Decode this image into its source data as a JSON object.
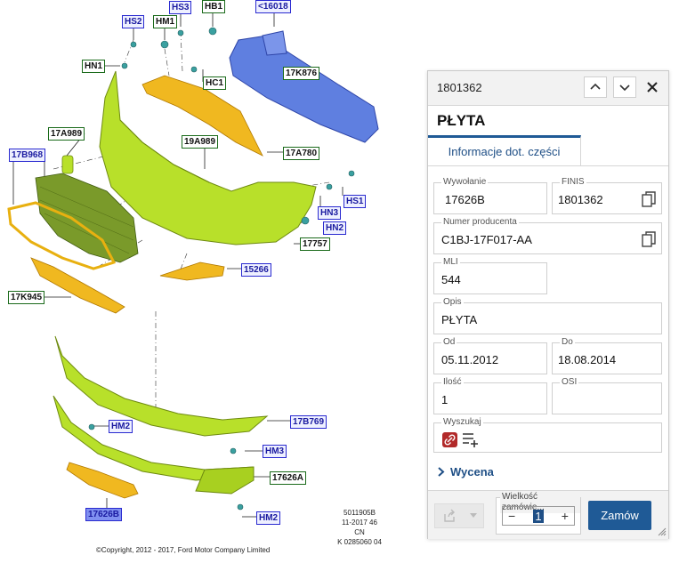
{
  "diagram": {
    "labels": [
      "HS2",
      "HM1",
      "HS3",
      "HB1",
      "<16018",
      "HN1",
      "HC1",
      "17K876",
      "17A989",
      "19A989",
      "17A780",
      "17B968",
      "HS1",
      "HN3",
      "HN2",
      "17757",
      "15266",
      "17K945",
      "17B769",
      "HM2",
      "HM3",
      "17626A",
      "17626B",
      "HM2"
    ],
    "ref_lines": [
      "5011905B",
      "11-2017 46",
      "CN",
      "K 0285060 04"
    ],
    "copyright": "©Copyright, 2012 - 2017, Ford Motor Company Limited",
    "colors": {
      "bumper_green": "#b8e02a",
      "bracket_orange": "#f0b820",
      "beam_blue": "#5f7fe0"
    }
  },
  "panel": {
    "part_id": "1801362",
    "title": "PŁYTA",
    "tab": "Informacje dot. części",
    "fields": {
      "wywolanie": {
        "label": "Wywołanie",
        "value": "17626B"
      },
      "finis": {
        "label": "FINIS",
        "value": "1801362"
      },
      "numer": {
        "label": "Numer producenta",
        "value": "C1BJ-17F017-AA"
      },
      "mli": {
        "label": "MLI",
        "value": "544"
      },
      "opis": {
        "label": "Opis",
        "value": "PŁYTA"
      },
      "od": {
        "label": "Od",
        "value": "05.11.2012"
      },
      "do": {
        "label": "Do",
        "value": "18.08.2014"
      },
      "ilosc": {
        "label": "Ilość",
        "value": "1"
      },
      "osi": {
        "label": "OSI",
        "value": ""
      },
      "wyszukaj": {
        "label": "Wyszukaj"
      }
    },
    "wycena": "Wycena",
    "quantity": {
      "label": "Wielkość zamówie...",
      "value": "1",
      "minus": "−",
      "plus": "+"
    },
    "order_button": "Zamów",
    "icons": [
      "chevron-up-icon",
      "chevron-down-icon",
      "close-icon",
      "copy-icon",
      "link-icon",
      "list-add-icon",
      "chevron-right-icon",
      "share-icon",
      "caret-down-icon",
      "resize-grip-icon"
    ]
  }
}
